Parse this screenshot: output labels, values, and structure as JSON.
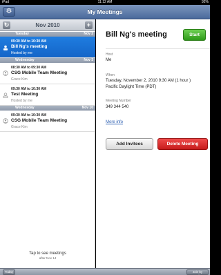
{
  "status_bar": {
    "device": "iPad",
    "time": "11:12 AM",
    "battery": "92%"
  },
  "navbar": {
    "title": "My Meetings"
  },
  "sidebar": {
    "month": "Nov 2010",
    "sections": [
      {
        "day": "Tuesday",
        "date": "Nov 2"
      },
      {
        "day": "Wednesday",
        "date": "Nov 3"
      },
      {
        "day": "Wednesday",
        "date": "Nov 10"
      }
    ],
    "meetings": [
      {
        "time": "09:30 AM to 10:30 AM",
        "name": "Bill Ng's meeting",
        "sub": "Hosted by me"
      },
      {
        "time": "08:30 AM to 09:30 AM",
        "name": "CSG Mobile Team Meeting",
        "sub": "Grace Kim"
      },
      {
        "time": "09:30 AM to 10:30 AM",
        "name": "Test Meeting",
        "sub": "Hosted by me"
      },
      {
        "time": "09:30 AM to 10:30 AM",
        "name": "CSG Mobile Team Meeting",
        "sub": "Grace Kim"
      }
    ],
    "footer": {
      "main": "Tap to see meetings",
      "sub": "after Nov 14"
    }
  },
  "detail": {
    "title": "Bill Ng's meeting",
    "start_label": "Start",
    "host_label": "Host",
    "host_value": "Me",
    "when_label": "When",
    "when_line1": "Tuesday, November 2, 2010 9:30 AM (1 hour )",
    "when_line2": "Pacific Daylight Time (PDT)",
    "number_label": "Meeting Number",
    "number_value": "349 344 540",
    "more_info": "More info",
    "add_invitees": "Add Invitees",
    "delete_meeting": "Delete Meeting"
  },
  "toolbar": {
    "today": "Today",
    "join": "Join by Number"
  },
  "colors": {
    "accent_blue": "#1f7de0",
    "start_green": "#2e9a19",
    "delete_red": "#c61c1c",
    "nav_blue": "#4a6a9c"
  }
}
